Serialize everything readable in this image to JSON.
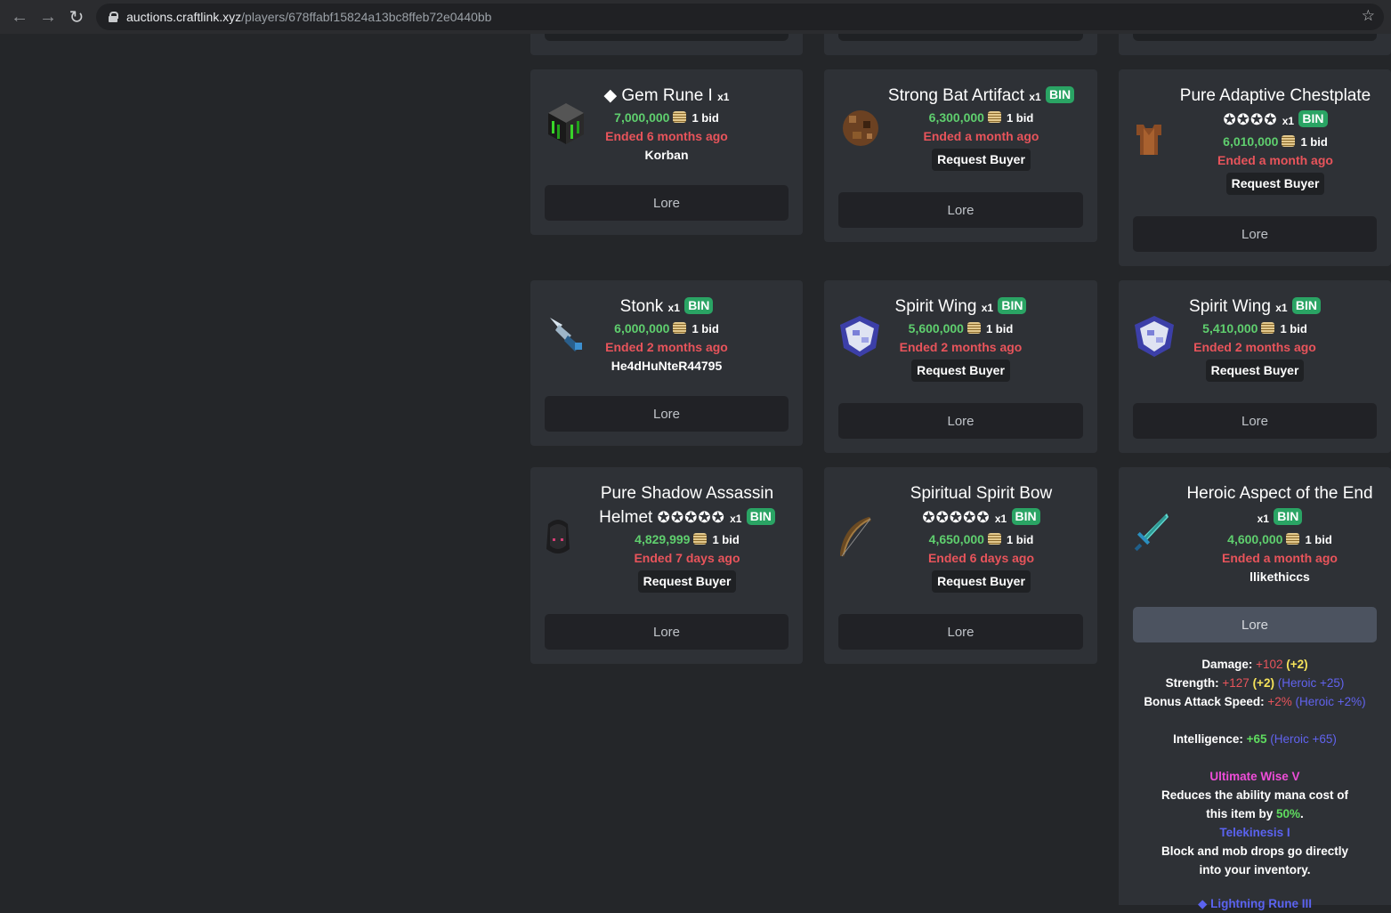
{
  "browser": {
    "url_host": "auctions.craftlink.xyz",
    "url_path": "/players/678ffabf15824a13bc8ffeb72e0440bb"
  },
  "auctions": [
    {
      "name": "◆ Gem Rune I",
      "qty": "x1",
      "bin": "",
      "price": "7,000,000",
      "bids": "1 bid",
      "ended": "Ended 6 months ago",
      "seller": "Korban",
      "lore_label": "Lore",
      "icon": "gem-rune-icon"
    },
    {
      "name": "Strong Bat Artifact",
      "qty": "x1",
      "bin": "BIN",
      "price": "6,300,000",
      "bids": "1 bid",
      "ended": "Ended a month ago",
      "request_buyer": "Request Buyer",
      "lore_label": "Lore",
      "icon": "bat-artifact-icon"
    },
    {
      "name": "Pure Adaptive Chestplate",
      "stars": "✪✪✪✪",
      "qty": "x1",
      "bin": "BIN",
      "price": "6,010,000",
      "bids": "1 bid",
      "ended": "Ended a month ago",
      "request_buyer": "Request Buyer",
      "lore_label": "Lore",
      "icon": "chestplate-icon"
    },
    {
      "name": "Stonk",
      "qty": "x1",
      "bin": "BIN",
      "price": "6,000,000",
      "bids": "1 bid",
      "ended": "Ended 2 months ago",
      "seller": "He4dHuNteR44795",
      "lore_label": "Lore",
      "icon": "stonk-drill-icon"
    },
    {
      "name": "Spirit Wing",
      "qty": "x1",
      "bin": "BIN",
      "price": "5,600,000",
      "bids": "1 bid",
      "ended": "Ended 2 months ago",
      "request_buyer": "Request Buyer",
      "lore_label": "Lore",
      "icon": "spirit-wing-icon"
    },
    {
      "name": "Spirit Wing",
      "qty": "x1",
      "bin": "BIN",
      "price": "5,410,000",
      "bids": "1 bid",
      "ended": "Ended 2 months ago",
      "request_buyer": "Request Buyer",
      "lore_label": "Lore",
      "icon": "spirit-wing-icon"
    },
    {
      "name": "Pure Shadow Assassin Helmet",
      "name_line1": "Pure Shadow Assassin",
      "name_line2": "Helmet",
      "stars": "✪✪✪✪✪",
      "qty": "x1",
      "bin": "BIN",
      "price": "4,829,999",
      "bids": "1 bid",
      "ended": "Ended 7 days ago",
      "request_buyer": "Request Buyer",
      "lore_label": "Lore",
      "icon": "helmet-icon"
    },
    {
      "name": "Spiritual Spirit Bow",
      "stars": "✪✪✪✪✪",
      "qty": "x1",
      "bin": "BIN",
      "price": "4,650,000",
      "bids": "1 bid",
      "ended": "Ended 6 days ago",
      "request_buyer": "Request Buyer",
      "lore_label": "Lore",
      "icon": "bow-icon"
    },
    {
      "name": "Heroic Aspect of the End",
      "qty": "x1",
      "bin": "BIN",
      "price": "4,600,000",
      "bids": "1 bid",
      "ended": "Ended a month ago",
      "seller": "llikethiccs",
      "lore_label": "Lore",
      "icon": "sword-icon"
    }
  ],
  "lore": {
    "damage_label": "Damage:",
    "damage_val": "+102",
    "damage_bonus": "(+2)",
    "strength_label": "Strength:",
    "strength_val": "+127",
    "strength_bonus": "(+2)",
    "strength_heroic": "(Heroic +25)",
    "bas_label": "Bonus Attack Speed:",
    "bas_val": "+2%",
    "bas_heroic": "(Heroic +2%)",
    "int_label": "Intelligence:",
    "int_val": "+65",
    "int_heroic": "(Heroic +65)",
    "ench1": "Ultimate Wise V",
    "ench1_desc_a": "Reduces the ability mana cost of",
    "ench1_desc_b": "this item by",
    "ench1_pct": "50%",
    "ench1_dot": ".",
    "ench2": "Telekinesis I",
    "ench2_desc_a": "Block and mob drops go directly",
    "ench2_desc_b": "into your inventory.",
    "ench3": "◆ Lightning Rune III"
  }
}
